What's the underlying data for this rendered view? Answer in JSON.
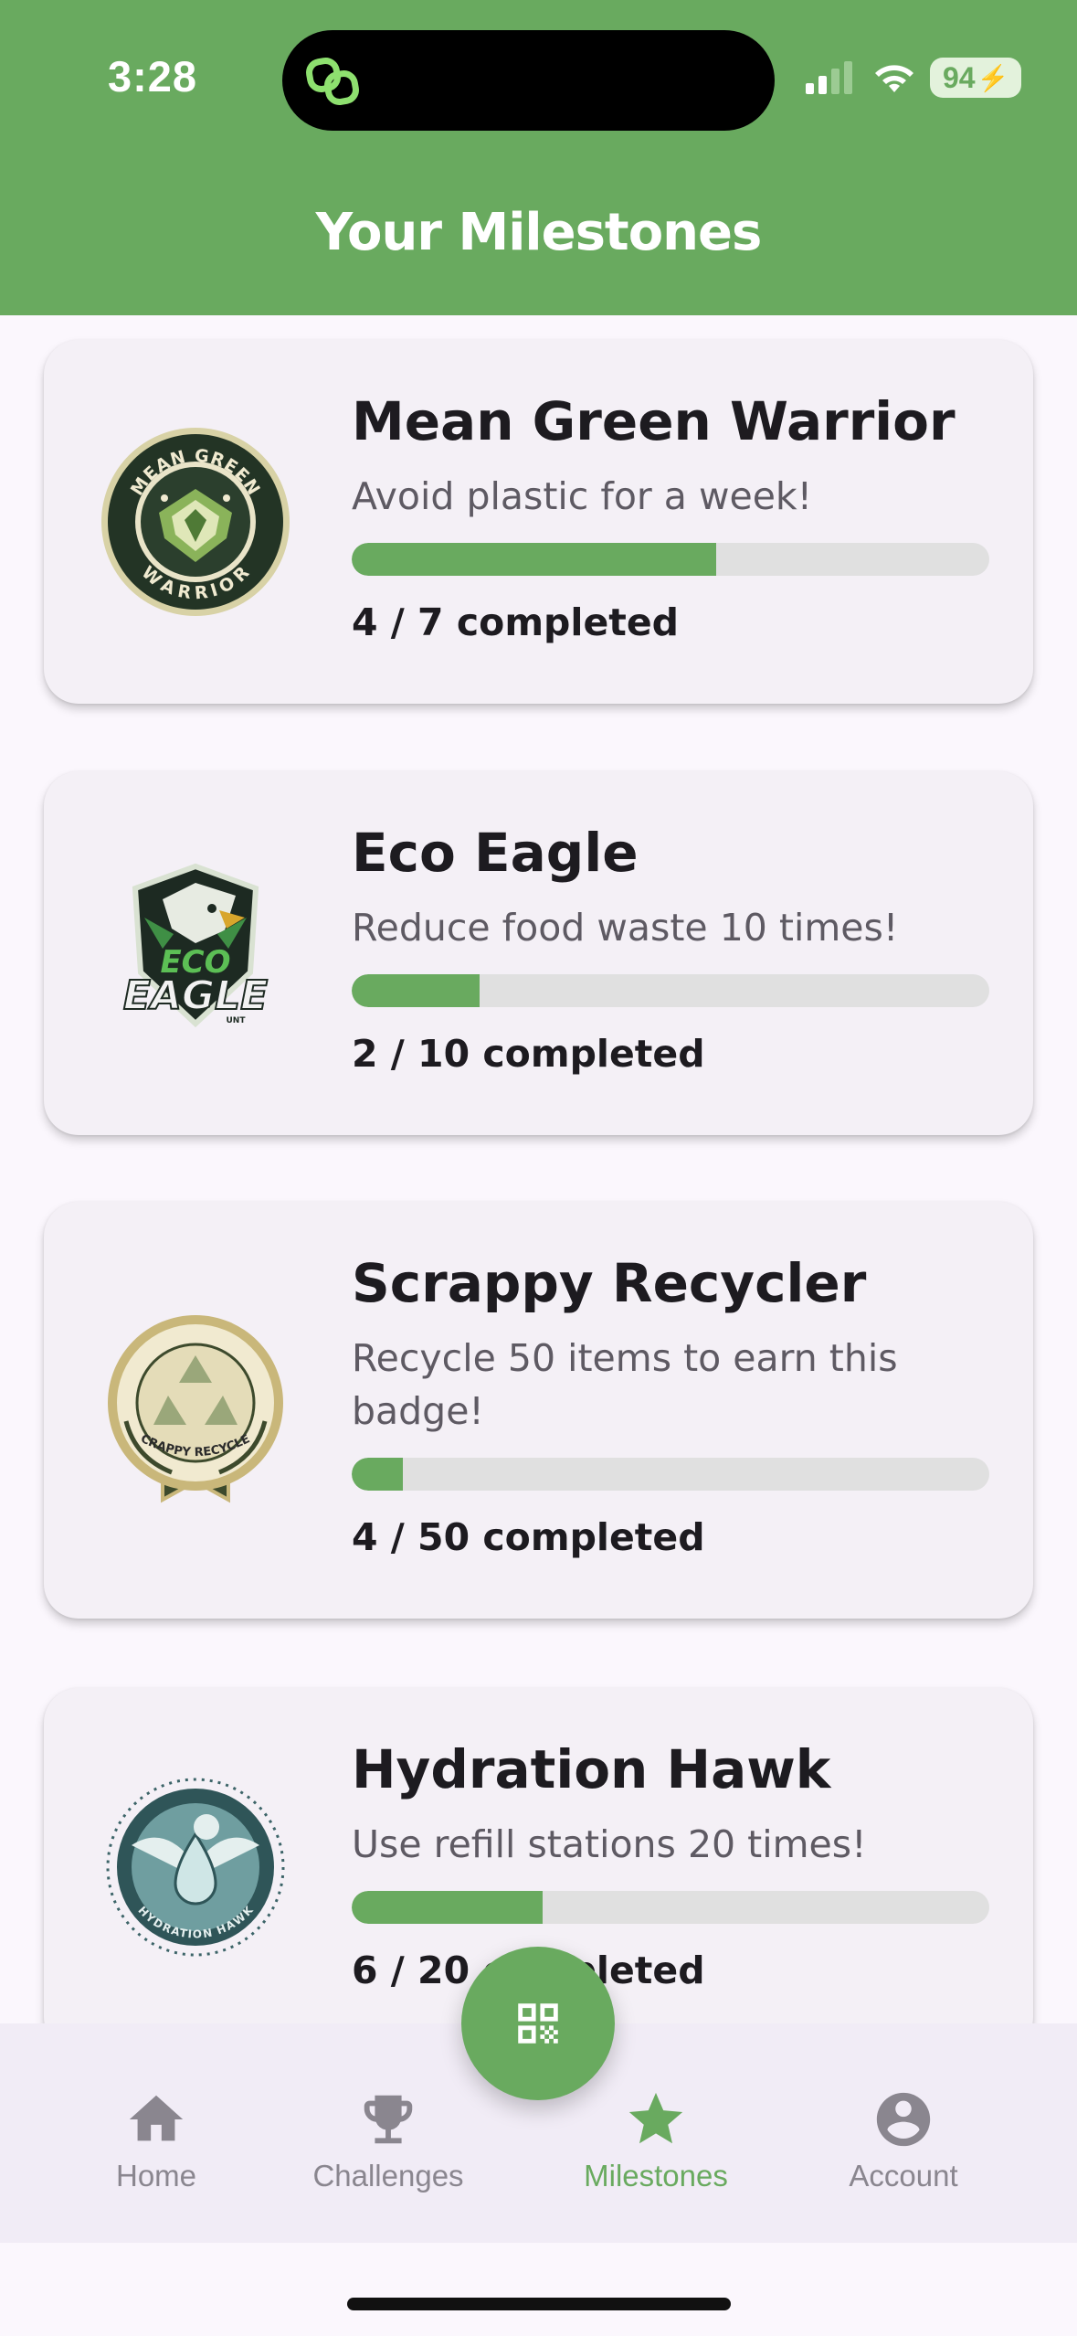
{
  "status_bar": {
    "time": "3:28",
    "battery": "94"
  },
  "header": {
    "title": "Your Milestones"
  },
  "milestones": [
    {
      "title": "Mean Green Warrior",
      "description": "Avoid plastic for a week!",
      "progress": "4 / 7 completed",
      "completed": 4,
      "total": 7,
      "badge_top_text": "MEAN GREEN",
      "badge_bottom_text": "WARRIOR"
    },
    {
      "title": "Eco Eagle",
      "description": "Reduce food waste 10 times!",
      "progress": "2 / 10 completed",
      "completed": 2,
      "total": 10,
      "badge_top_text": "ECO",
      "badge_bottom_text": "EAGLE",
      "badge_small_text": "UNT"
    },
    {
      "title": "Scrappy Recycler",
      "description": "Recycle 50 items to earn this badge!",
      "progress": "4 / 50 completed",
      "completed": 4,
      "total": 50,
      "badge_ribbon_text": "SCRAPPY RECYCLER"
    },
    {
      "title": "Hydration Hawk",
      "description": "Use refill stations 20 times!",
      "progress": "6 / 20 completed",
      "completed": 6,
      "total": 20,
      "badge_ring_text": "HYDRATION HAWK"
    }
  ],
  "bottom_nav": {
    "items": [
      {
        "label": "Home",
        "icon": "home-icon"
      },
      {
        "label": "Challenges",
        "icon": "trophy-icon"
      },
      {
        "label": "Milestones",
        "icon": "star-icon"
      },
      {
        "label": "Account",
        "icon": "account-icon"
      }
    ],
    "active": "Milestones",
    "fab_icon": "qr-code-icon"
  },
  "colors": {
    "primary": "#69aa5f",
    "background": "#fbf7fd",
    "card": "#f4f0f6",
    "track": "#e0e0e0",
    "nav_inactive": "#8a868f"
  }
}
